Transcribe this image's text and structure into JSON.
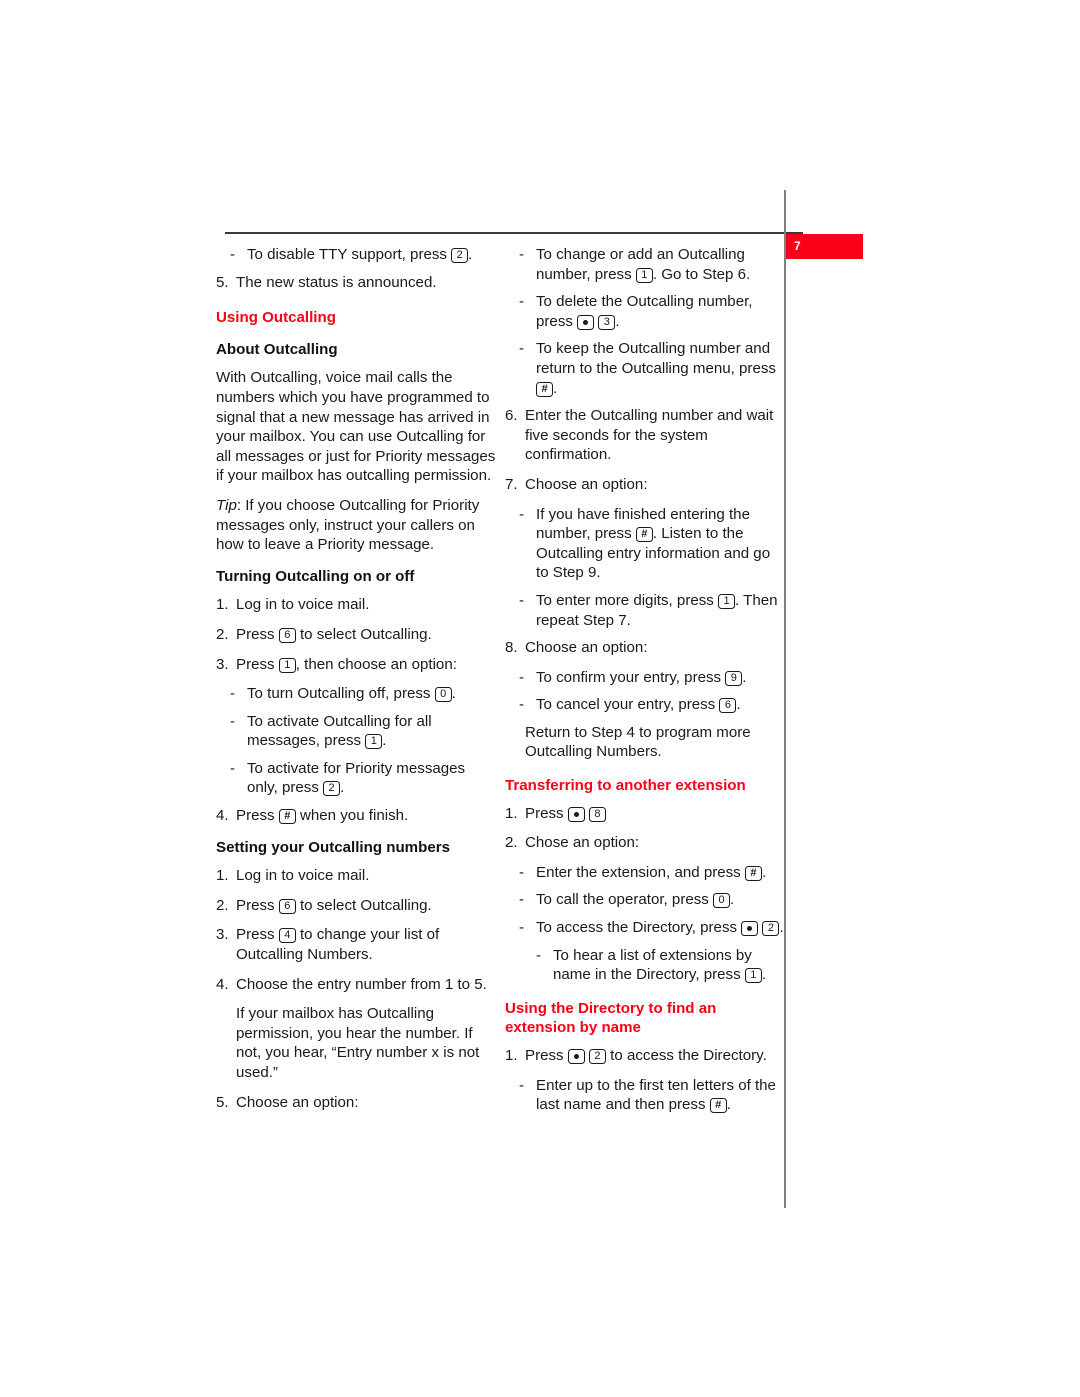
{
  "page": {
    "folio_number": "7",
    "accent_color": "#fb0016",
    "text_color": "#1a1a1a",
    "rule_color": "#808080"
  },
  "left_column": {
    "top_dash": {
      "lead": "To disable TTY support, press ",
      "key": "2",
      "tail": "."
    },
    "step5_top": {
      "number": "5.",
      "text": "The new status is announced."
    },
    "heading_using_outcalling": "Using Outcalling",
    "heading_about_outcalling": "About Outcalling",
    "about_para": "With Outcalling, voice mail calls the numbers which you have programmed to signal that a new message has arrived in your mailbox. You can use Outcalling for all messages or just for Priority messages if your mailbox has outcalling permission.",
    "tip_label": "Tip",
    "tip_text": ": If you choose Outcalling for Priority messages only, instruct your callers on how to leave a Priority message.",
    "heading_turning_on_off": "Turning Outcalling on or off",
    "turning_steps": [
      {
        "number": "1.",
        "text": "Log in to voice mail."
      },
      {
        "number": "2.",
        "lead": "Press ",
        "key": "6",
        "tail": " to select Outcalling."
      },
      {
        "number": "3.",
        "lead": "Press ",
        "key": "1",
        "tail": ", then choose an option:"
      }
    ],
    "turning_options": [
      {
        "lead": "To turn Outcalling off, press ",
        "key": "0",
        "tail": "."
      },
      {
        "lead": "To activate Outcalling for all messages, press ",
        "key": "1",
        "tail": "."
      },
      {
        "lead": "To activate for Priority messages only, press ",
        "key": "2",
        "tail": "."
      }
    ],
    "turning_step4": {
      "number": "4.",
      "lead": "Press ",
      "key": "#",
      "tail": " when you finish."
    },
    "heading_setting_numbers": "Setting your Outcalling numbers",
    "setting_steps": [
      {
        "number": "1.",
        "text": "Log in to voice mail."
      },
      {
        "number": "2.",
        "lead": "Press ",
        "key": "6",
        "tail": " to select Outcalling."
      },
      {
        "number": "3.",
        "lead": "Press ",
        "key": "4",
        "tail": " to change your list of Outcalling Numbers."
      },
      {
        "number": "4.",
        "text": "Choose the entry number from 1 to 5."
      }
    ],
    "setting_note": "If your mailbox has Outcalling permission, you hear the number. If not, you hear, “Entry number x is not used.”",
    "setting_step5": {
      "number": "5.",
      "text": "Choose an option:"
    }
  },
  "right_column": {
    "step5_options": [
      {
        "lead": "To change or add an Outcalling number, press ",
        "key": "1",
        "tail": ". Go to Step 6."
      },
      {
        "lead": "To delete the Outcalling number, press ",
        "key_star": "*",
        "key": "3",
        "tail": "."
      },
      {
        "lead": "To keep the Outcalling number and return to the Outcalling menu, press ",
        "key": "#",
        "tail": "."
      }
    ],
    "step6": {
      "number": "6.",
      "text": "Enter the Outcalling number and wait five seconds for the system confirmation."
    },
    "step7": {
      "number": "7.",
      "text": "Choose an option:"
    },
    "step7_options": [
      {
        "lead": "If you have finished entering the number, press ",
        "key": "#",
        "tail": ". Listen to the Outcalling entry information and go to Step 9."
      },
      {
        "lead": "To enter more digits, press ",
        "key": "1",
        "tail": ". Then repeat Step 7."
      }
    ],
    "step8": {
      "number": "8.",
      "text": "Choose an option:"
    },
    "step8_options": [
      {
        "lead": "To confirm your entry, press ",
        "key": "9",
        "tail": "."
      },
      {
        "lead": "To cancel your entry, press ",
        "key": "6",
        "tail": "."
      }
    ],
    "return_note": "Return to Step 4 to program more Outcalling Numbers.",
    "heading_transferring": "Transferring to another extension",
    "transfer_step1": {
      "number": "1.",
      "lead": "Press ",
      "key_star": "*",
      "key": "8",
      "tail": ""
    },
    "transfer_step2": {
      "number": "2.",
      "text": "Chose an option:"
    },
    "transfer_options": [
      {
        "lead": "Enter the extension, and press ",
        "key": "#",
        "tail": "."
      },
      {
        "lead": "To call the operator, press ",
        "key": "0",
        "tail": "."
      },
      {
        "lead": "To access the Directory, press ",
        "key_star": "*",
        "key": "2",
        "tail": "."
      }
    ],
    "transfer_subdash": {
      "lead": "To hear a list of extensions by name in the Directory, press ",
      "key": "1",
      "tail": "."
    },
    "heading_directory": "Using the Directory to find an extension by name",
    "directory_step1": {
      "number": "1.",
      "lead": "Press ",
      "key_star": "*",
      "key": "2",
      "tail": " to access the Directory."
    },
    "directory_dash": {
      "lead": "Enter up to the first ten letters of the last name and then press ",
      "key": "#",
      "tail": "."
    }
  }
}
